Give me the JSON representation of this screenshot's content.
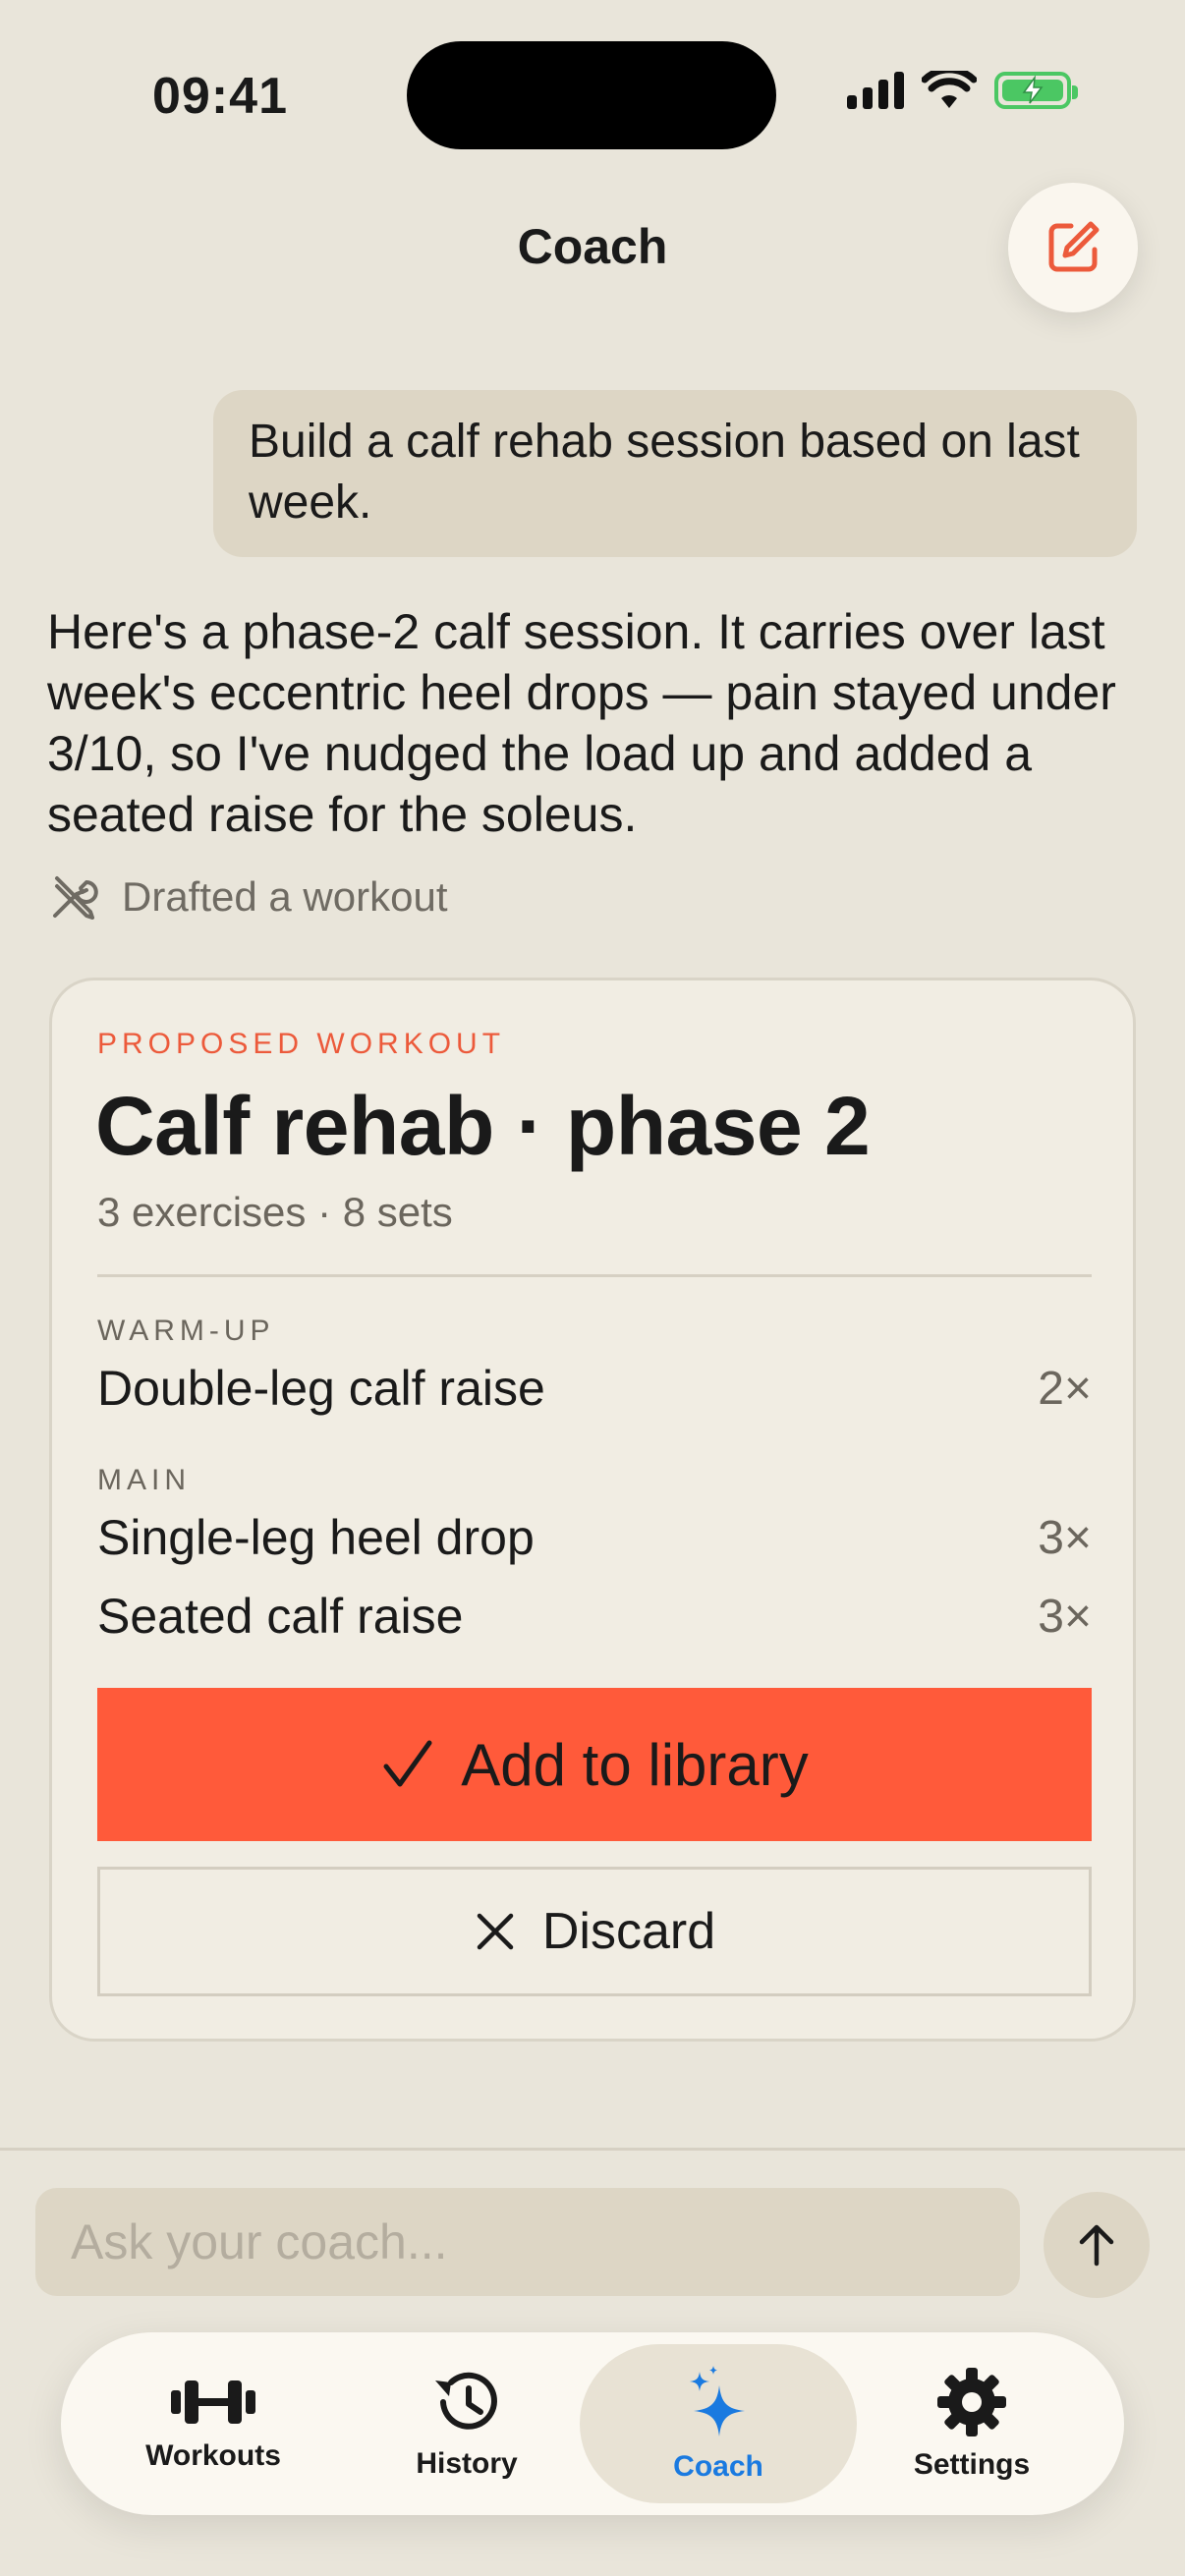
{
  "status_bar": {
    "time": "09:41"
  },
  "header": {
    "title": "Coach"
  },
  "chat": {
    "user_message": "Build a calf rehab session based on last week.",
    "assistant_message": "Here's a phase-2 calf session. It carries over last week's eccentric heel drops — pain stayed under 3/10, so I've nudged the load up and added a seated raise for the soleus.",
    "tool_call": "Drafted a workout"
  },
  "card": {
    "kicker": "PROPOSED WORKOUT",
    "title": "Calf rehab · phase 2",
    "subtitle": "3 exercises · 8 sets",
    "sections": [
      {
        "label": "WARM-UP",
        "exercises": [
          {
            "name": "Double-leg calf raise",
            "sets": "2×"
          }
        ]
      },
      {
        "label": "MAIN",
        "exercises": [
          {
            "name": "Single-leg heel drop",
            "sets": "3×"
          },
          {
            "name": "Seated calf raise",
            "sets": "3×"
          }
        ]
      }
    ],
    "add_label": "Add to library",
    "discard_label": "Discard"
  },
  "composer": {
    "placeholder": "Ask your coach..."
  },
  "tabs": [
    {
      "label": "Workouts",
      "icon": "dumbbell-icon",
      "active": false
    },
    {
      "label": "History",
      "icon": "history-icon",
      "active": false
    },
    {
      "label": "Coach",
      "icon": "sparkles-icon",
      "active": true
    },
    {
      "label": "Settings",
      "icon": "gear-icon",
      "active": false
    }
  ],
  "colors": {
    "background": "#e9e5da",
    "accent": "#ff5a3a",
    "active_tab": "#1a7ae0",
    "battery": "#4bc763"
  }
}
